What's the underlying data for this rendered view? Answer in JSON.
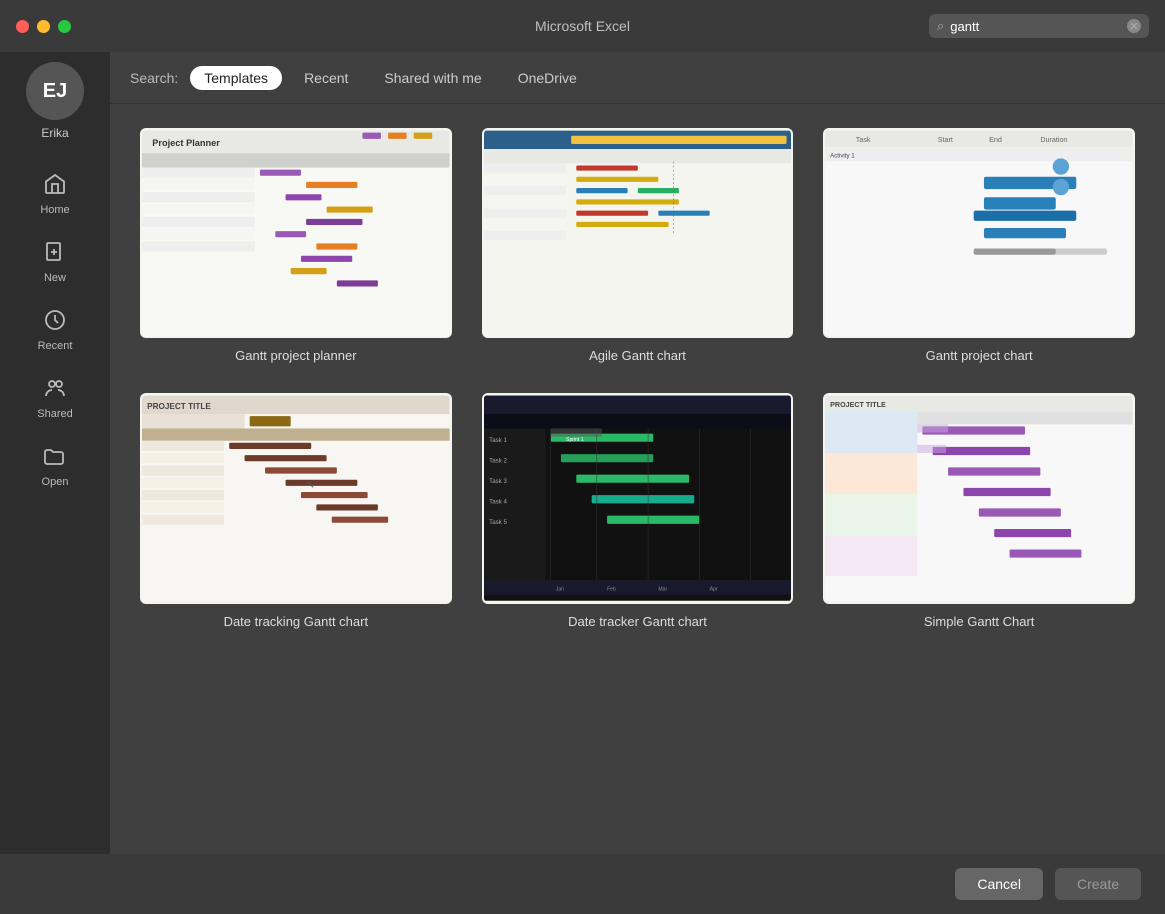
{
  "titlebar": {
    "title": "Microsoft Excel",
    "search_placeholder": "gantt",
    "search_value": "gantt"
  },
  "sidebar": {
    "avatar_initials": "EJ",
    "avatar_name": "Erika",
    "items": [
      {
        "id": "home",
        "label": "Home",
        "icon": "🏠"
      },
      {
        "id": "new",
        "label": "New",
        "icon": "📄+"
      },
      {
        "id": "recent",
        "label": "Recent",
        "icon": "🕐"
      },
      {
        "id": "shared",
        "label": "Shared",
        "icon": "👥"
      },
      {
        "id": "open",
        "label": "Open",
        "icon": "📁"
      }
    ]
  },
  "filter": {
    "label": "Search:",
    "options": [
      {
        "id": "templates",
        "label": "Templates",
        "active": true
      },
      {
        "id": "recent",
        "label": "Recent",
        "active": false
      },
      {
        "id": "shared-with-me",
        "label": "Shared with me",
        "active": false
      },
      {
        "id": "onedrive",
        "label": "OneDrive",
        "active": false
      }
    ]
  },
  "templates": [
    {
      "id": "gantt-project-planner",
      "name": "Gantt project planner",
      "thumb_type": "planner"
    },
    {
      "id": "agile-gantt-chart",
      "name": "Agile Gantt chart",
      "thumb_type": "agile"
    },
    {
      "id": "gantt-project-chart",
      "name": "Gantt project chart",
      "thumb_type": "project-chart"
    },
    {
      "id": "date-tracking-gantt",
      "name": "Date tracking Gantt chart",
      "thumb_type": "date-tracking"
    },
    {
      "id": "date-tracker-gantt",
      "name": "Date tracker Gantt chart",
      "thumb_type": "date-tracker"
    },
    {
      "id": "simple-gantt-chart",
      "name": "Simple Gantt Chart",
      "thumb_type": "simple"
    }
  ],
  "footer": {
    "cancel_label": "Cancel",
    "create_label": "Create"
  }
}
